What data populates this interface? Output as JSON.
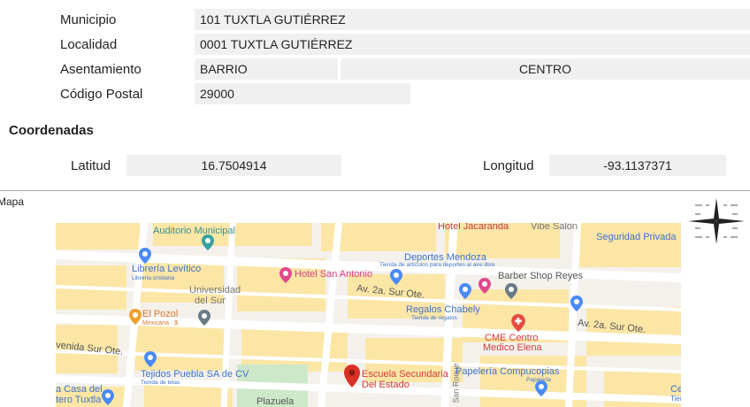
{
  "address": {
    "municipio_label": "Municipio",
    "municipio_value": "101 TUXTLA GUTIÉRREZ",
    "localidad_label": "Localidad",
    "localidad_value": "0001 TUXTLA GUTIÉRREZ",
    "asentamiento_label": "Asentamiento",
    "asentamiento_type": "BARRIO",
    "asentamiento_value": "CENTRO",
    "cp_label": "Código Postal",
    "cp_value": "29000"
  },
  "coords": {
    "title": "Coordenadas",
    "lat_label": "Latitud",
    "lat_value": "16.7504914",
    "lon_label": "Longitud",
    "lon_value": "-93.1137371"
  },
  "map": {
    "title": "Mapa",
    "labels": {
      "hotel_jacaranda": "Hotel Jacaranda",
      "vibe_salon": "Vibe Salon",
      "seguridad_privada": "Seguridad Privada",
      "auditorio": "Auditorio Municipal",
      "deportes_mendoza": "Deportes Mendoza",
      "deportes_sub": "Tienda de artículos para deportes al aire libre",
      "libreria": "Librería Levítico",
      "libreria_sub": "Librería cristiana",
      "hotel_san_antonio": "Hotel San Antonio",
      "barber_shop": "Barber Shop Reyes",
      "universidad_1": "Universidad",
      "universidad_2": "del Sur",
      "av2_sur_1": "Av. 2a. Sur Ote.",
      "av2_sur_2": "Av. 2a. Sur Ote.",
      "el_pozol": "El Pozol",
      "el_pozol_sub": "Mexicana · $",
      "regalos": "Regalos Chabely",
      "regalos_sub": "Tienda de regalos",
      "cme_1": "CME Centro",
      "cme_2": "Medico Elena",
      "venida_sur": "venida Sur Ote.",
      "tejidos": "Tejidos Puebla SA de CV",
      "tejidos_sub": "Tienda de telas",
      "escuela_1": "Escuela Secundaria",
      "escuela_2": "Del Estado",
      "san_roque": "San Roque",
      "papeleria": "Papelería Compucopias",
      "papeleria_sub": "Papelería",
      "casa_del_1": "a Casa del",
      "casa_del_2": "tero Tuxtla",
      "plazuela": "Plazuela",
      "cer_1": "Cer",
      "cer_2": "Tien"
    }
  },
  "colors": {
    "field_bg": "#f0f0f0",
    "map_road": "#ffffff",
    "map_bg": "#f4f1ec",
    "map_block_yellow": "#fbe6a6",
    "label_blue": "#3f73c8",
    "label_pink": "#d6408a",
    "label_orange": "#d9782a",
    "label_red": "#d23a3a",
    "pin_blue": "#4a8af4",
    "pin_red": "#e64a3e",
    "pin_pink": "#e0488b",
    "pin_teal": "#3aa0a0",
    "pin_orange": "#f0a030"
  }
}
